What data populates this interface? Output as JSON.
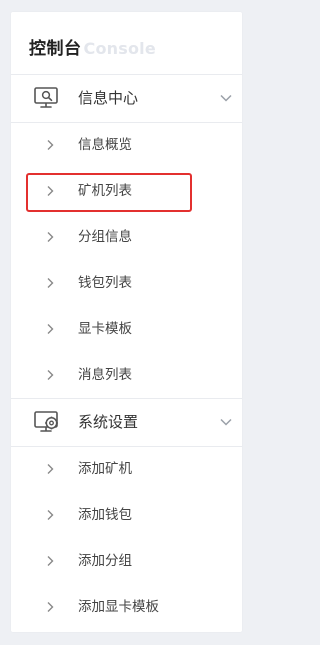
{
  "brand": {
    "title_cn": "控制台",
    "title_en": "Console"
  },
  "groups": [
    {
      "label": "信息中心",
      "icon": "monitor-search-icon",
      "expanded": true,
      "items": [
        {
          "label": "信息概览"
        },
        {
          "label": "矿机列表"
        },
        {
          "label": "分组信息"
        },
        {
          "label": "钱包列表"
        },
        {
          "label": "显卡模板"
        },
        {
          "label": "消息列表"
        }
      ]
    },
    {
      "label": "系统设置",
      "icon": "monitor-settings-icon",
      "expanded": true,
      "items": [
        {
          "label": "添加矿机"
        },
        {
          "label": "添加钱包"
        },
        {
          "label": "添加分组"
        },
        {
          "label": "添加显卡模板"
        }
      ]
    }
  ],
  "colors": {
    "background": "#eef0f4",
    "panel": "#ffffff",
    "highlight": "#e3302f",
    "text": "#333333",
    "icon": "#555555"
  }
}
